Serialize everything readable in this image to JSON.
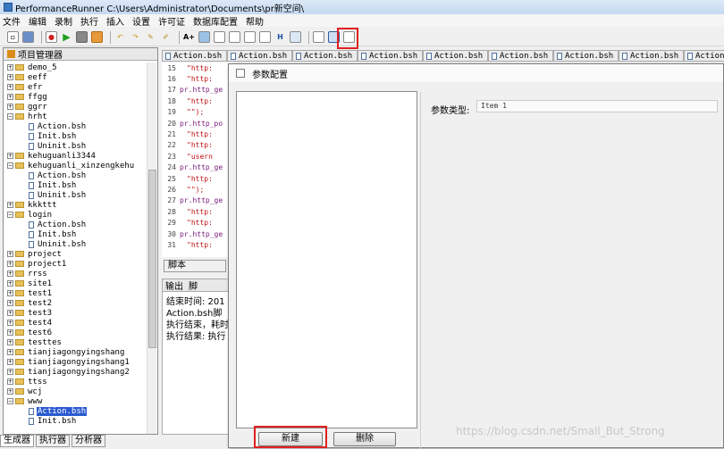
{
  "window": {
    "title": "PerformanceRunner  C:\\Users\\Administrator\\Documents\\pr新空间\\"
  },
  "menu": [
    "文件",
    "编辑",
    "录制",
    "执行",
    "插入",
    "设置",
    "许可证",
    "数据库配置",
    "帮助"
  ],
  "toolbar_icons": [
    "new-icon",
    "save-icon",
    "record-icon",
    "run-icon",
    "stop-icon",
    "folder-icon",
    "undo-icon",
    "redo-icon",
    "tool-icon",
    "tool2-icon",
    "add-text-icon",
    "add-node-icon",
    "edit-icon",
    "edit2-icon",
    "edit3-icon",
    "edit4-icon",
    "hh-icon",
    "screen-icon",
    "param-file-icon",
    "param-config-icon",
    "param-doc-icon"
  ],
  "project_panel": {
    "title": "项目管理器"
  },
  "tree": [
    {
      "label": "demo_5",
      "type": "folder",
      "level": 0,
      "expanded": false
    },
    {
      "label": "eeff",
      "type": "folder",
      "level": 0,
      "expanded": false
    },
    {
      "label": "efr",
      "type": "folder",
      "level": 0,
      "expanded": false
    },
    {
      "label": "ffgg",
      "type": "folder",
      "level": 0,
      "expanded": false
    },
    {
      "label": "ggrr",
      "type": "folder",
      "level": 0,
      "expanded": false
    },
    {
      "label": "hrht",
      "type": "folder",
      "level": 0,
      "expanded": true
    },
    {
      "label": "Action.bsh",
      "type": "file",
      "level": 1
    },
    {
      "label": "Init.bsh",
      "type": "file",
      "level": 1
    },
    {
      "label": "Uninit.bsh",
      "type": "file",
      "level": 1
    },
    {
      "label": "kehuguanli3344",
      "type": "folder",
      "level": 0,
      "expanded": false
    },
    {
      "label": "kehuguanli_xinzengkehu",
      "type": "folder",
      "level": 0,
      "expanded": true
    },
    {
      "label": "Action.bsh",
      "type": "file",
      "level": 1
    },
    {
      "label": "Init.bsh",
      "type": "file",
      "level": 1
    },
    {
      "label": "Uninit.bsh",
      "type": "file",
      "level": 1
    },
    {
      "label": "kkkttt",
      "type": "folder",
      "level": 0,
      "expanded": false
    },
    {
      "label": "login",
      "type": "folder",
      "level": 0,
      "expanded": true
    },
    {
      "label": "Action.bsh",
      "type": "file",
      "level": 1
    },
    {
      "label": "Init.bsh",
      "type": "file",
      "level": 1
    },
    {
      "label": "Uninit.bsh",
      "type": "file",
      "level": 1
    },
    {
      "label": "project",
      "type": "folder",
      "level": 0,
      "expanded": false
    },
    {
      "label": "project1",
      "type": "folder",
      "level": 0,
      "expanded": false
    },
    {
      "label": "rrss",
      "type": "folder",
      "level": 0,
      "expanded": false
    },
    {
      "label": "site1",
      "type": "folder",
      "level": 0,
      "expanded": false
    },
    {
      "label": "test1",
      "type": "folder",
      "level": 0,
      "expanded": false
    },
    {
      "label": "test2",
      "type": "folder",
      "level": 0,
      "expanded": false
    },
    {
      "label": "test3",
      "type": "folder",
      "level": 0,
      "expanded": false
    },
    {
      "label": "test4",
      "type": "folder",
      "level": 0,
      "expanded": false
    },
    {
      "label": "test6",
      "type": "folder",
      "level": 0,
      "expanded": false
    },
    {
      "label": "testtes",
      "type": "folder",
      "level": 0,
      "expanded": false
    },
    {
      "label": "tianjiagongyingshang",
      "type": "folder",
      "level": 0,
      "expanded": false
    },
    {
      "label": "tianjiagongyingshang1",
      "type": "folder",
      "level": 0,
      "expanded": false
    },
    {
      "label": "tianjiagongyingshang2",
      "type": "folder",
      "level": 0,
      "expanded": false
    },
    {
      "label": "ttss",
      "type": "folder",
      "level": 0,
      "expanded": false
    },
    {
      "label": "wcj",
      "type": "folder",
      "level": 0,
      "expanded": false
    },
    {
      "label": "www",
      "type": "folder",
      "level": 0,
      "expanded": true
    },
    {
      "label": "Action.bsh",
      "type": "file",
      "level": 1,
      "selected": true
    },
    {
      "label": "Init.bsh",
      "type": "file",
      "level": 1
    }
  ],
  "bottom_tabs": [
    "生成器",
    "执行器",
    "分析器"
  ],
  "editor_tabs": [
    "Action.bsh",
    "Action.bsh",
    "Action.bsh",
    "Action.bsh",
    "Action.bsh",
    "Action.bsh",
    "Action.bsh",
    "Action.bsh",
    "Action.bsh",
    "Action.bsh"
  ],
  "code_lines": [
    {
      "num": "15",
      "text": "\"http:",
      "cls": "str",
      "indent": true
    },
    {
      "num": "16",
      "text": "\"http:",
      "cls": "str",
      "indent": true
    },
    {
      "num": "17",
      "text": "pr.http_ge",
      "cls": "",
      "indent": false
    },
    {
      "num": "18",
      "text": "\"http:",
      "cls": "str",
      "indent": true
    },
    {
      "num": "19",
      "text": "\"\");",
      "cls": "str",
      "indent": true
    },
    {
      "num": "20",
      "text": "pr.http_po",
      "cls": "",
      "indent": false
    },
    {
      "num": "21",
      "text": "\"http:",
      "cls": "str",
      "indent": true
    },
    {
      "num": "22",
      "text": "\"http:",
      "cls": "str",
      "indent": true
    },
    {
      "num": "23",
      "text": "\"usern",
      "cls": "str",
      "indent": true
    },
    {
      "num": "24",
      "text": "pr.http_ge",
      "cls": "",
      "indent": false
    },
    {
      "num": "25",
      "text": "\"http:",
      "cls": "str",
      "indent": true
    },
    {
      "num": "26",
      "text": "\"\");",
      "cls": "str",
      "indent": true
    },
    {
      "num": "27",
      "text": "pr.http_ge",
      "cls": "",
      "indent": false
    },
    {
      "num": "28",
      "text": "\"http:",
      "cls": "str",
      "indent": true
    },
    {
      "num": "29",
      "text": "\"http:",
      "cls": "str",
      "indent": true
    },
    {
      "num": "30",
      "text": "pr.http_ge",
      "cls": "",
      "indent": false
    },
    {
      "num": "31",
      "text": "\"http:",
      "cls": "str",
      "indent": true
    }
  ],
  "script_tab": "脚本",
  "output": {
    "tabs": [
      "输出",
      "脚"
    ],
    "lines": [
      "结束时间: 201",
      "Action.bsh脚",
      "执行结束，耗时",
      "执行结果: 执行"
    ]
  },
  "dialog": {
    "title": "参数配置",
    "param_type_label": "参数类型:",
    "param_type_value": "Item 1",
    "new_button": "新建",
    "delete_button": "删除"
  },
  "watermark": "https://blog.csdn.net/Small_But_Strong"
}
